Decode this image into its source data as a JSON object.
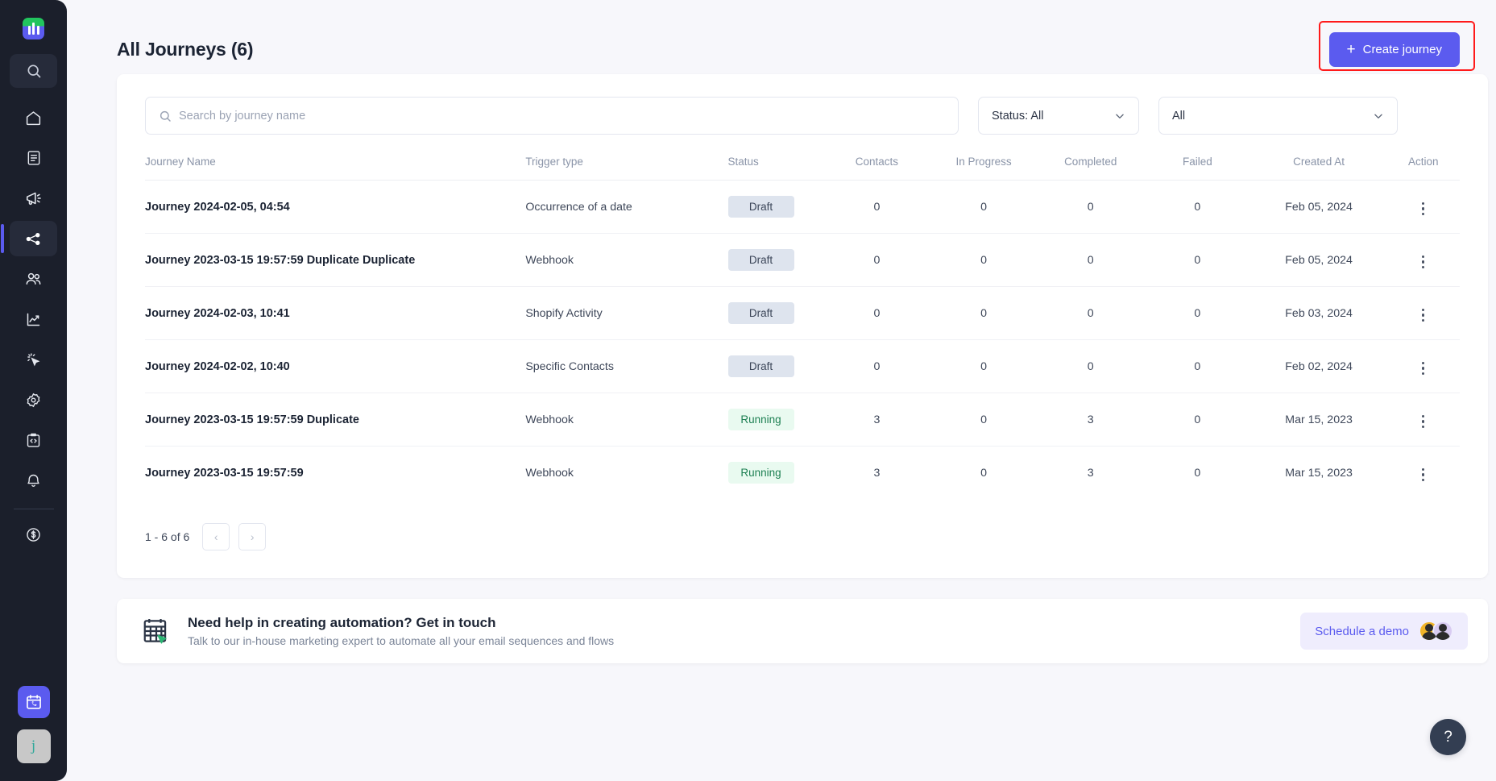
{
  "sidebar": {
    "logo_name": "mailmodo-logo",
    "search_icon": "search-icon",
    "items": [
      {
        "icon": "home-icon",
        "name": "home"
      },
      {
        "icon": "template-icon",
        "name": "templates"
      },
      {
        "icon": "campaign-icon",
        "name": "campaigns"
      },
      {
        "icon": "journey-icon",
        "name": "journeys",
        "active": true
      },
      {
        "icon": "contacts-icon",
        "name": "contacts"
      },
      {
        "icon": "analytics-icon",
        "name": "analytics"
      },
      {
        "icon": "click-icon",
        "name": "click-tracking"
      },
      {
        "icon": "settings-icon",
        "name": "settings"
      },
      {
        "icon": "code-icon",
        "name": "developers"
      },
      {
        "icon": "bell-icon",
        "name": "notifications"
      },
      {
        "icon": "billing-icon",
        "name": "billing"
      }
    ],
    "calendar_icon": "calendar-call-icon",
    "avatar_initial": "j"
  },
  "header": {
    "title": "All Journeys (6)",
    "create_label": "Create journey",
    "create_plus": "+",
    "accent_color": "#5B5BEF",
    "highlight_color": "#FF1A1A"
  },
  "filters": {
    "search_placeholder": "Search by journey name",
    "search_value": "",
    "search_icon": "search-icon",
    "status_label": "Status: All",
    "type_label": "All",
    "chevron": "⌄"
  },
  "table": {
    "columns": [
      "Journey Name",
      "Trigger type",
      "Status",
      "Contacts",
      "In Progress",
      "Completed",
      "Failed",
      "Created At",
      "Action"
    ],
    "rows": [
      {
        "name": "Journey 2024-02-05, 04:54",
        "trigger": "Occurrence of a date",
        "status": "Draft",
        "status_kind": "draft",
        "contacts": "0",
        "in_progress": "0",
        "completed": "0",
        "failed": "0",
        "created_at": "Feb 05, 2024"
      },
      {
        "name": "Journey 2023-03-15 19:57:59 Duplicate Duplicate",
        "trigger": "Webhook",
        "status": "Draft",
        "status_kind": "draft",
        "contacts": "0",
        "in_progress": "0",
        "completed": "0",
        "failed": "0",
        "created_at": "Feb 05, 2024"
      },
      {
        "name": "Journey 2024-02-03, 10:41",
        "trigger": "Shopify Activity",
        "status": "Draft",
        "status_kind": "draft",
        "contacts": "0",
        "in_progress": "0",
        "completed": "0",
        "failed": "0",
        "created_at": "Feb 03, 2024"
      },
      {
        "name": "Journey 2024-02-02, 10:40",
        "trigger": "Specific Contacts",
        "status": "Draft",
        "status_kind": "draft",
        "contacts": "0",
        "in_progress": "0",
        "completed": "0",
        "failed": "0",
        "created_at": "Feb 02, 2024"
      },
      {
        "name": "Journey 2023-03-15 19:57:59 Duplicate",
        "trigger": "Webhook",
        "status": "Running",
        "status_kind": "running",
        "contacts": "3",
        "in_progress": "0",
        "completed": "3",
        "failed": "0",
        "created_at": "Mar 15, 2023"
      },
      {
        "name": "Journey 2023-03-15 19:57:59",
        "trigger": "Webhook",
        "status": "Running",
        "status_kind": "running",
        "contacts": "3",
        "in_progress": "0",
        "completed": "3",
        "failed": "0",
        "created_at": "Mar 15, 2023"
      }
    ],
    "status_colors": {
      "draft_bg": "#DEE4EE",
      "draft_text": "#3C4659",
      "running_bg": "#E9FAF0",
      "running_text": "#1E8053"
    }
  },
  "pagination": {
    "range_label": "1 - 6 of 6",
    "prev": "‹",
    "next": "›"
  },
  "promo": {
    "icon": "calendar-cursor-icon",
    "title": "Need help in creating automation? Get in touch",
    "subtitle": "Talk to our in-house marketing expert to automate all your email sequences and flows",
    "button_label": "Schedule a demo",
    "button_bg": "#EFEDFD",
    "button_text_color": "#5B5BEF"
  },
  "help": {
    "icon": "question-mark-icon",
    "glyph": "?"
  }
}
